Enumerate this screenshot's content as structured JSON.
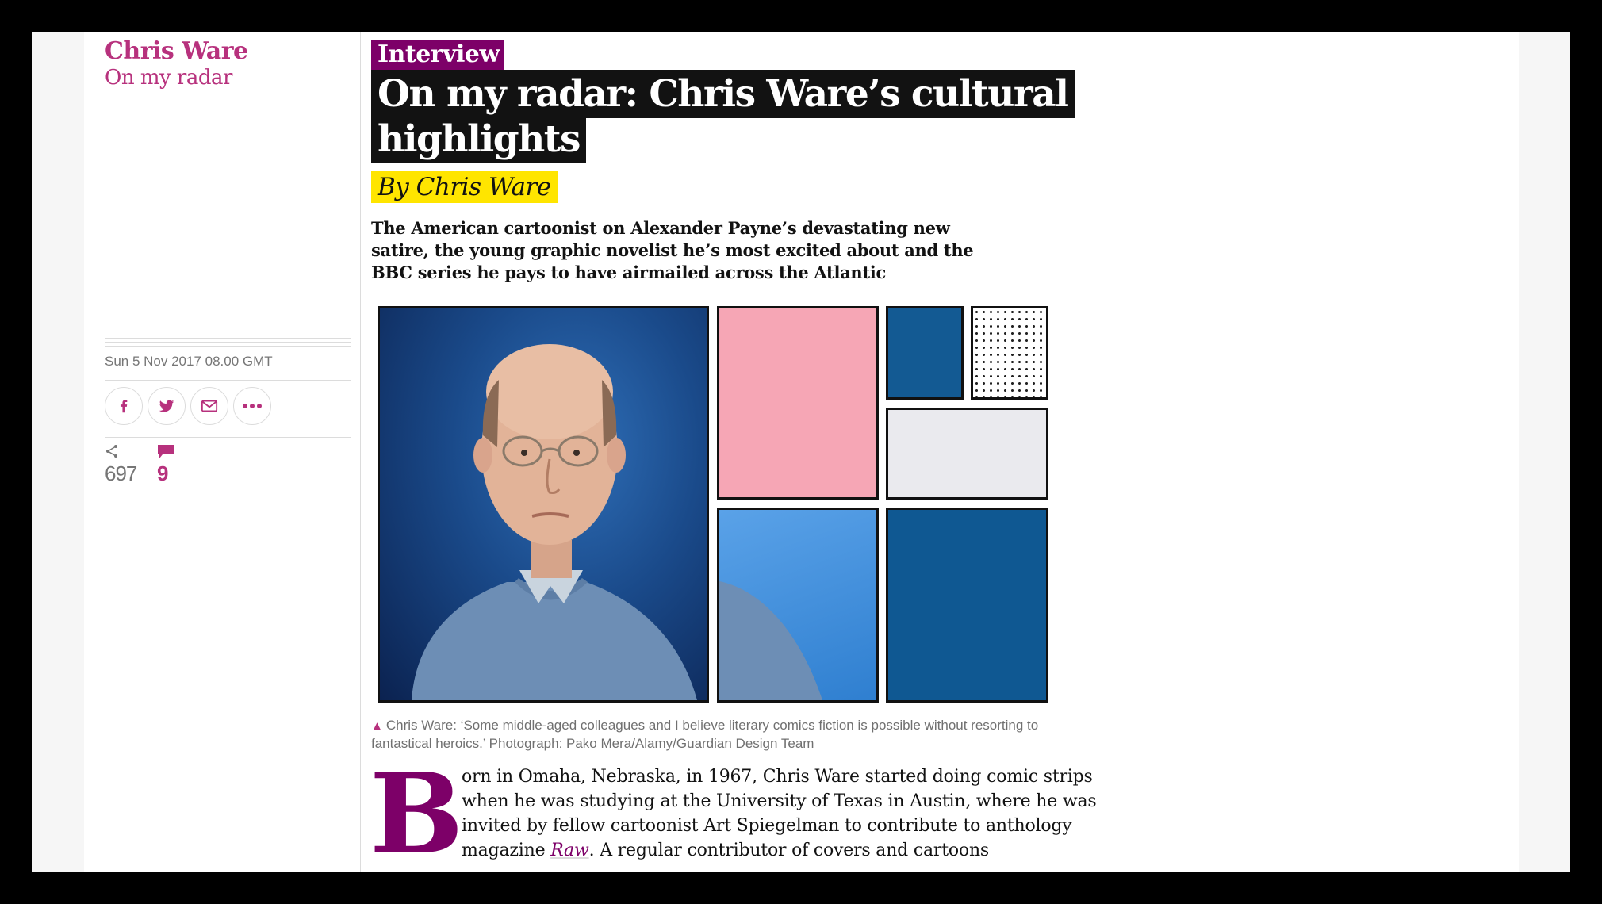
{
  "rail": {
    "series_title": "Chris Ware",
    "series_subtitle": "On my radar",
    "date": "Sun 5 Nov 2017 08.00 GMT",
    "share_count": "697",
    "comment_count": "9",
    "share_buttons": [
      "facebook-icon",
      "twitter-icon",
      "email-icon",
      "more-icon"
    ]
  },
  "article": {
    "kicker": "Interview",
    "headline": "On my radar: Chris Ware’s cultural highlights",
    "byline": "By Chris Ware",
    "standfirst": "The American cartoonist on Alexander Payne’s devastating new satire, the young graphic novelist he’s most excited about and the BBC series he pays to have airmailed across the Atlantic",
    "caption": "Chris Ware: ‘Some middle-aged colleagues and I believe literary comics fiction is possible without resorting to fantastical heroics.’ Photograph: Pako Mera/Alamy/Guardian Design Team",
    "dropcap": "B",
    "body_before_link": "orn in Omaha, Nebraska, in 1967, Chris Ware started doing comic strips when he was studying at the University of Texas in Austin, where he was invited by fellow cartoonist Art Spiegelman to contribute to anthology magazine ",
    "body_link": "Raw",
    "body_after_link": ". A regular contributor of covers and cartoons"
  },
  "colors": {
    "accent": "#b7317d",
    "kicker_bg": "#7d0068",
    "headline_bg": "#121212",
    "byline_bg": "#ffe500"
  }
}
